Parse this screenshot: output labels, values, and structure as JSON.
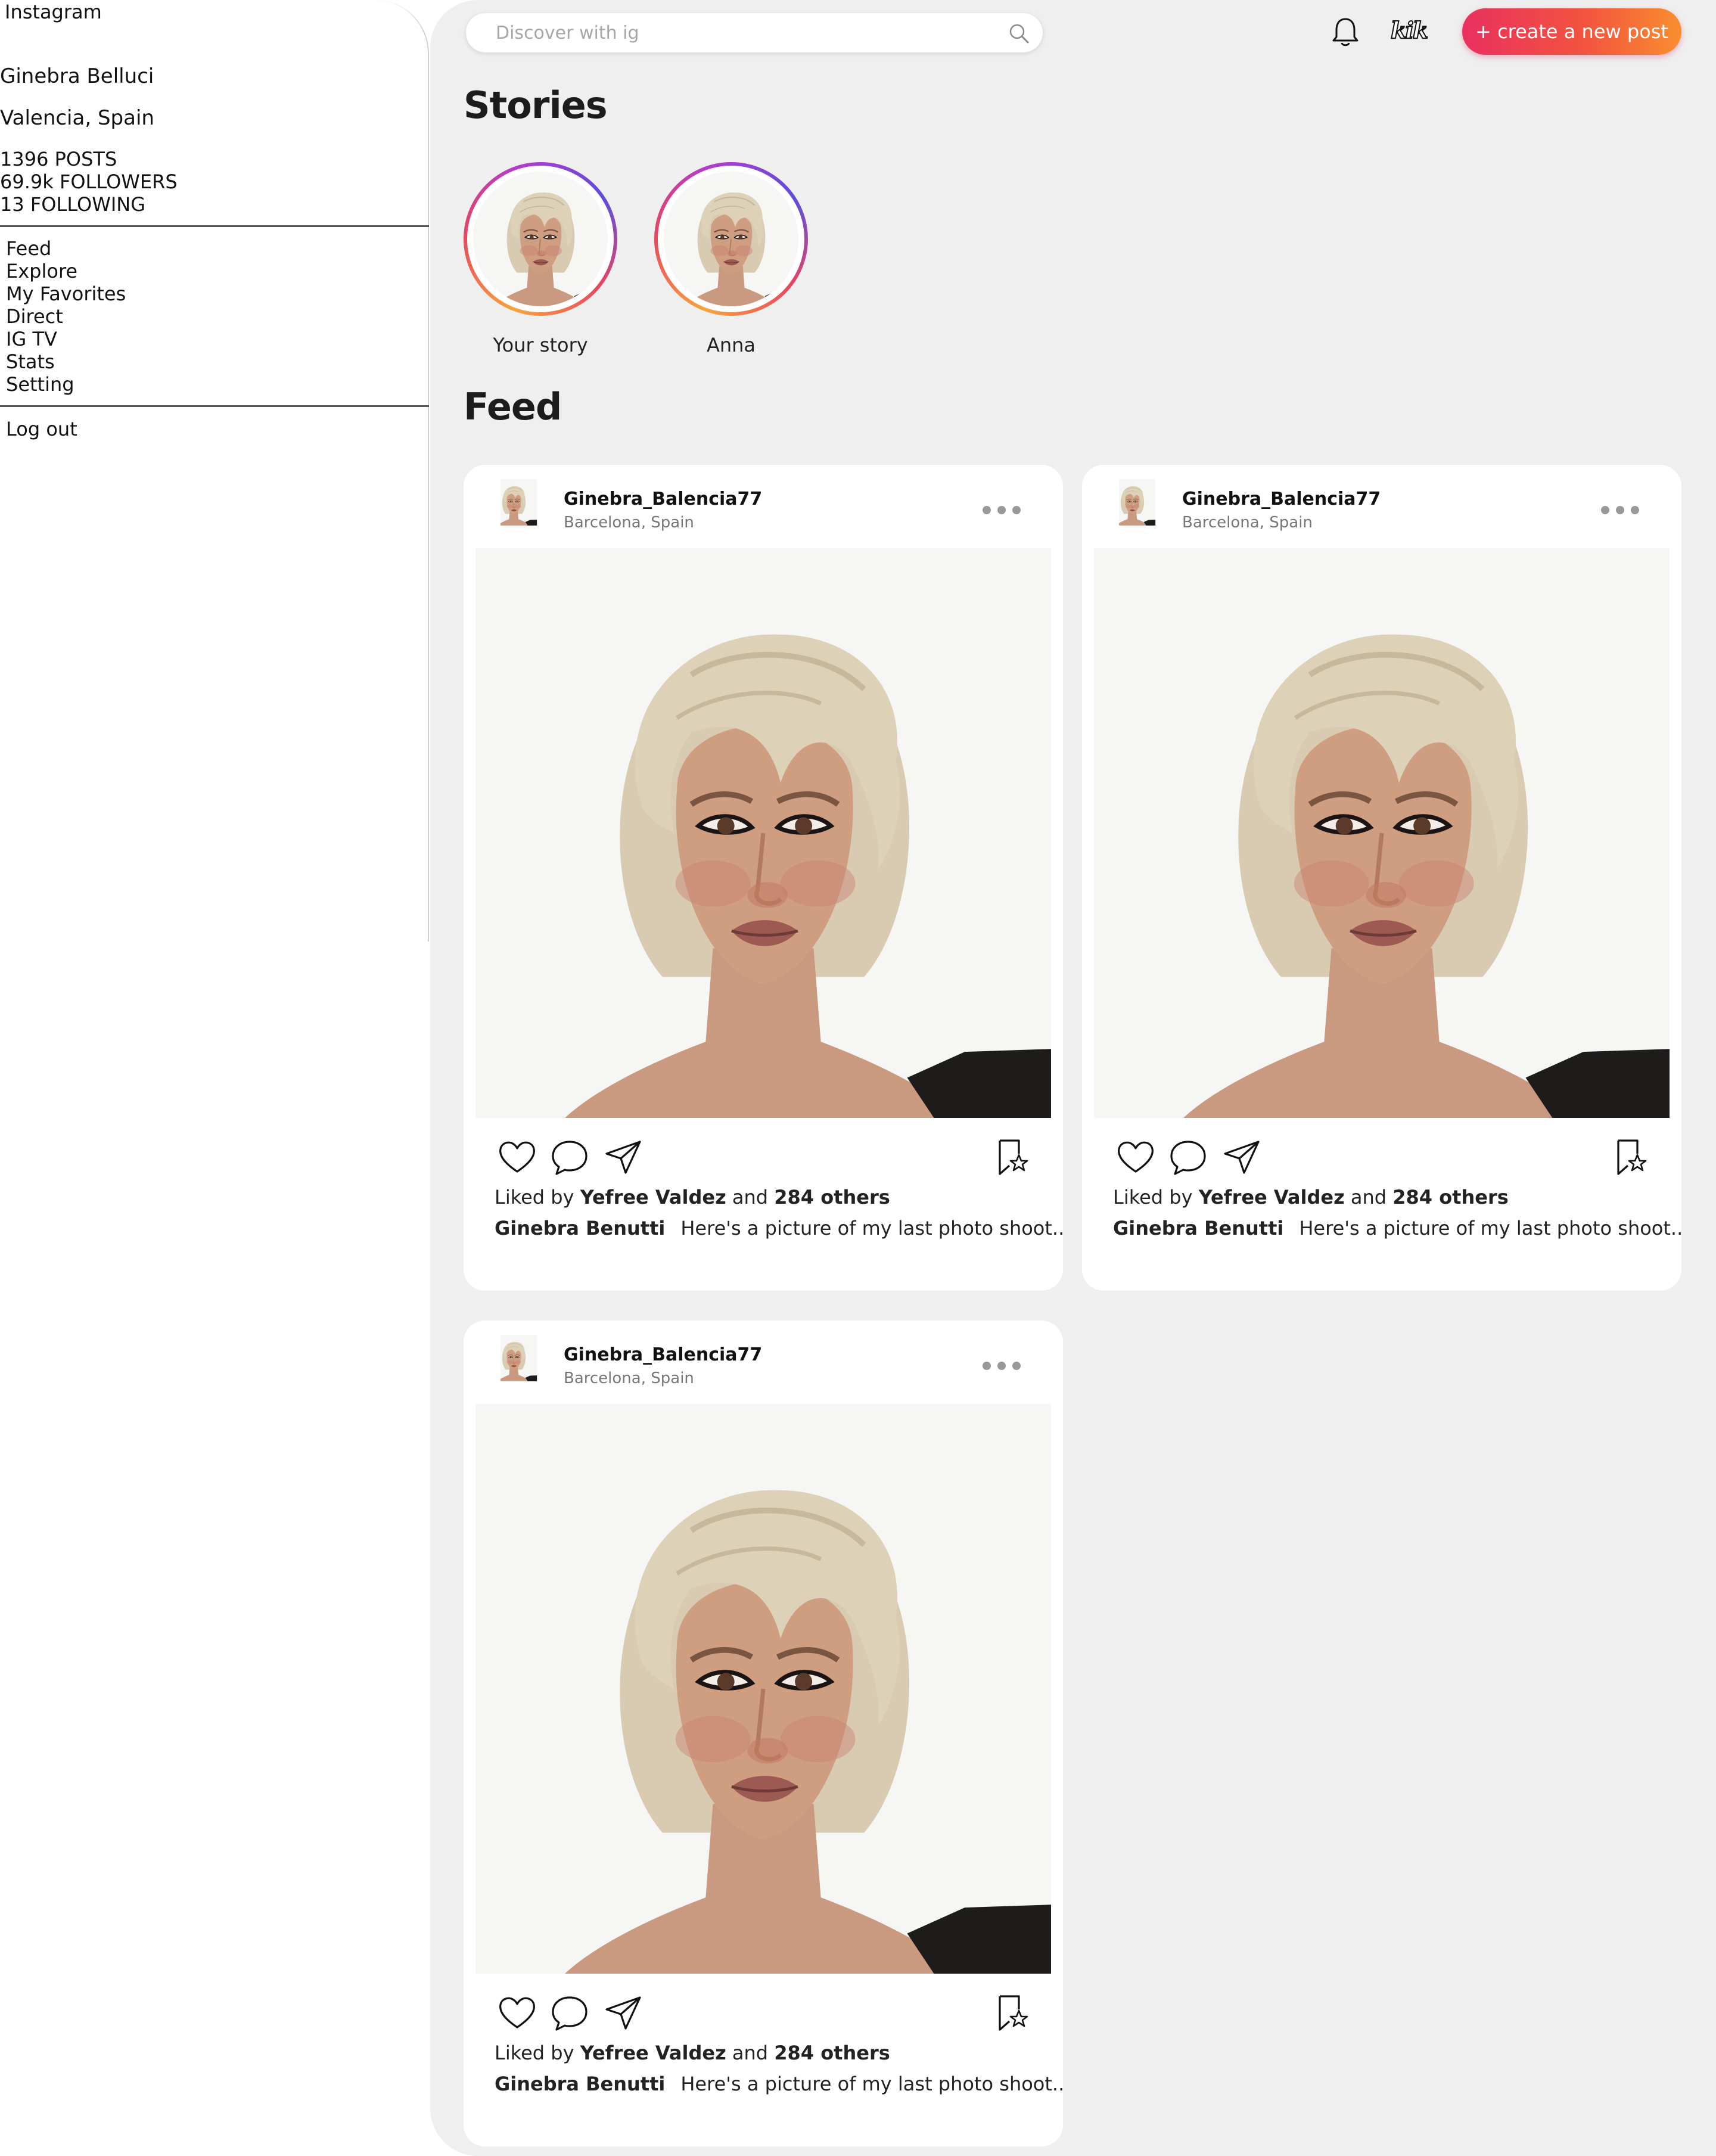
{
  "app": {
    "name": "Instagram"
  },
  "profile": {
    "name": "Ginebra Belluci",
    "location": "Valencia, Spain",
    "posts": "1396 POSTS",
    "followers": "69.9k FOLLOWERS",
    "following": "13 FOLLOWING"
  },
  "nav": {
    "items": [
      "Feed",
      "Explore",
      "My Favorites",
      "Direct",
      "IG TV",
      "Stats",
      "Setting"
    ],
    "logout": "Log out"
  },
  "header": {
    "search_placeholder": "Discover with ig",
    "logo_text": "kik",
    "create_button": "+ create a new post"
  },
  "stories": {
    "title": "Stories",
    "items": [
      {
        "label": "Your story"
      },
      {
        "label": "Anna"
      }
    ]
  },
  "feed": {
    "title": "Feed",
    "posts": [
      {
        "username": "Ginebra_Balencia77",
        "location": "Barcelona, Spain",
        "liked_prefix": "Liked by",
        "liked_user": "Yefree Valdez",
        "liked_and": "and",
        "liked_others": "284 others",
        "caption_user": "Ginebra Benutti",
        "caption_text": "Here's a picture of my last photo shoot.."
      },
      {
        "username": "Ginebra_Balencia77",
        "location": "Barcelona, Spain",
        "liked_prefix": "Liked by",
        "liked_user": "Yefree Valdez",
        "liked_and": "and",
        "liked_others": "284 others",
        "caption_user": "Ginebra Benutti",
        "caption_text": "Here's a picture of my last photo shoot.."
      },
      {
        "username": "Ginebra_Balencia77",
        "location": "Barcelona, Spain",
        "liked_prefix": "Liked by",
        "liked_user": "Yefree Valdez",
        "liked_and": "and",
        "liked_others": "284 others",
        "caption_user": "Ginebra Benutti",
        "caption_text": "Here's a picture of my last photo shoot.."
      }
    ]
  },
  "icons": {
    "search": "search-icon",
    "notifications": "bell-icon",
    "like": "heart-icon",
    "comment": "comment-icon",
    "share": "send-icon",
    "save": "bookmark-star-icon",
    "more": "more-dots-icon"
  },
  "colors": {
    "background": "#efefef",
    "card": "#ffffff",
    "create_gradient_start": "#e9305f",
    "create_gradient_end": "#f98e2f",
    "story_ring": "#e94560"
  }
}
